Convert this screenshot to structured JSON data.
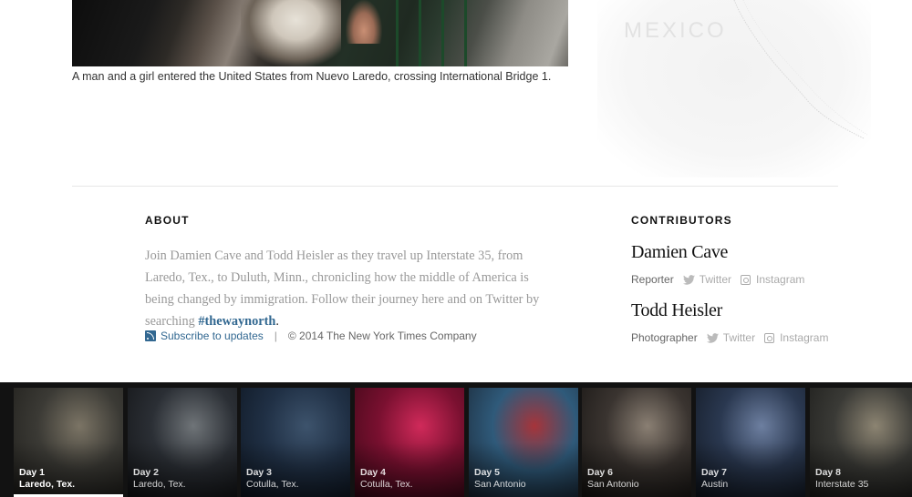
{
  "photo": {
    "caption": "A man and a girl entered the United States from Nuevo Laredo, crossing International Bridge 1."
  },
  "map": {
    "label": "MEXICO"
  },
  "about": {
    "heading": "ABOUT",
    "text_before": "Join Damien Cave and Todd Heisler as they travel up Interstate 35, from Laredo, Tex., to Duluth, Minn., chronicling how the middle of America is being changed by immigration. Follow their journey here and on Twitter by searching ",
    "hashtag": "#thewaynorth",
    "text_after": ".",
    "subscribe_label": "Subscribe to updates",
    "separator": "|",
    "copyright": "© 2014 The New York Times Company"
  },
  "contributors": {
    "heading": "CONTRIBUTORS",
    "people": [
      {
        "name": "Damien Cave",
        "role": "Reporter",
        "twitter": "Twitter",
        "instagram": "Instagram"
      },
      {
        "name": "Todd Heisler",
        "role": "Photographer",
        "twitter": "Twitter",
        "instagram": "Instagram"
      }
    ]
  },
  "days": [
    {
      "day": "Day 1",
      "place": "Laredo, Tex.",
      "active": true,
      "colors": [
        "#3b3a35",
        "#7b7465",
        "#1e1d1a"
      ]
    },
    {
      "day": "Day 2",
      "place": "Laredo, Tex.",
      "active": false,
      "colors": [
        "#2b2f35",
        "#6f7478",
        "#111214"
      ]
    },
    {
      "day": "Day 3",
      "place": "Cotulla, Tex.",
      "active": false,
      "colors": [
        "#203045",
        "#3d536c",
        "#0d1520"
      ]
    },
    {
      "day": "Day 4",
      "place": "Cotulla, Tex.",
      "active": false,
      "colors": [
        "#7a1030",
        "#d02a5a",
        "#3a0816"
      ]
    },
    {
      "day": "Day 5",
      "place": "San Antonio",
      "active": false,
      "colors": [
        "#2f5a7a",
        "#a6343a",
        "#1a2634"
      ]
    },
    {
      "day": "Day 6",
      "place": "San Antonio",
      "active": false,
      "colors": [
        "#3a3430",
        "#8a7f73",
        "#161412"
      ]
    },
    {
      "day": "Day 7",
      "place": "Austin",
      "active": false,
      "colors": [
        "#2a3850",
        "#6d7fa0",
        "#10161f"
      ]
    },
    {
      "day": "Day 8",
      "place": "Interstate 35",
      "active": false,
      "colors": [
        "#3a3a36",
        "#8c8472",
        "#1b1b19"
      ]
    }
  ]
}
